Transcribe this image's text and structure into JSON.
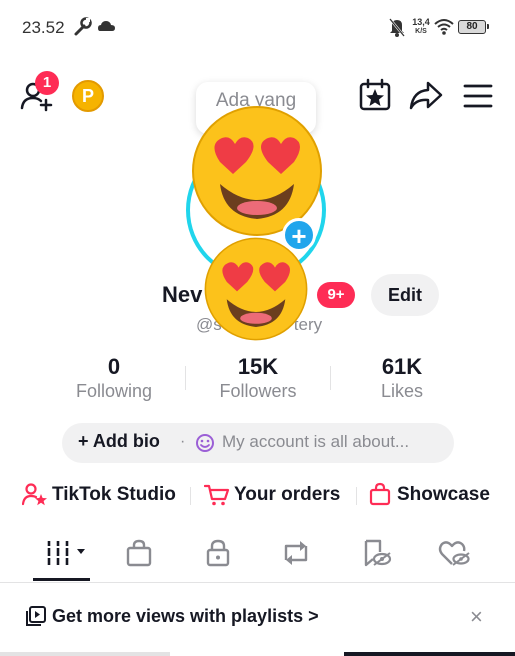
{
  "status_bar": {
    "time": "23.52",
    "net_speed_value": "13,4",
    "net_speed_unit": "K/S",
    "battery": "80"
  },
  "header": {
    "friends_badge": "1",
    "coin_letter": "P"
  },
  "profile": {
    "bubble_text": "Ada yang",
    "add_avatar_plus": "+",
    "name_visible": "Nev",
    "name_suffix": "e",
    "notification_badge": "9+",
    "edit_label": "Edit",
    "handle_prefix": "@s",
    "handle_suffix": "tery"
  },
  "stats": [
    {
      "value": "0",
      "label": "Following"
    },
    {
      "value": "15K",
      "label": "Followers"
    },
    {
      "value": "61K",
      "label": "Likes"
    }
  ],
  "bio": {
    "add_label": "+ Add bio",
    "separator": "·",
    "placeholder": "My account is all about..."
  },
  "links": [
    {
      "label": "TikTok Studio"
    },
    {
      "label": "Your orders"
    },
    {
      "label": "Showcase"
    }
  ],
  "banner": {
    "text": "Get more views with playlists >",
    "close": "×"
  },
  "colors": {
    "accent_red": "#fe2c55",
    "accent_blue": "#20d5ec",
    "coin": "#f6b300",
    "text": "#161823",
    "muted": "#8a8b91"
  }
}
